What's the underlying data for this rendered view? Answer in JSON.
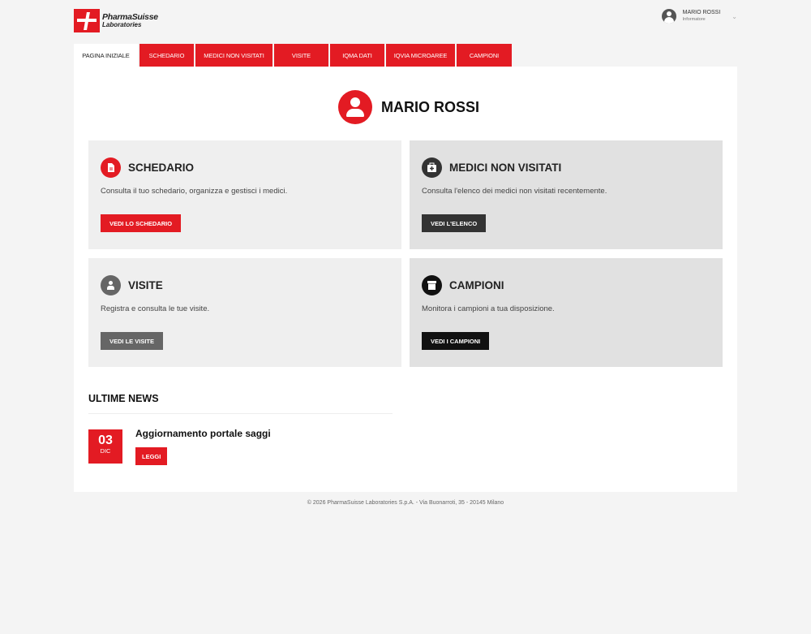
{
  "brand": {
    "name": "PharmaSuisse",
    "sub": "Laboratories",
    "color": "#e31b23"
  },
  "user": {
    "name": "MARIO ROSSI",
    "role": "Informatore",
    "icon": "user-circle-icon"
  },
  "nav": {
    "tabs": [
      {
        "label": "PAGINA INIZIALE",
        "active": true
      },
      {
        "label": "SCHEDARIO",
        "active": false
      },
      {
        "label": "MEDICI NON VISITATI",
        "active": false
      },
      {
        "label": "VISITE",
        "active": false
      },
      {
        "label": "IQMA DATI",
        "active": false
      },
      {
        "label": "IQVIA MICROAREE",
        "active": false
      },
      {
        "label": "CAMPIONI",
        "active": false
      }
    ]
  },
  "hero": {
    "name": "MARIO ROSSI"
  },
  "cards": [
    {
      "title": "SCHEDARIO",
      "description": "Consulta il tuo schedario, organizza e gestisci i medici.",
      "button": "VEDI LO SCHEDARIO",
      "icon": "document-icon",
      "icon_color": "#e31b23",
      "button_color": "#e31b23"
    },
    {
      "title": "MEDICI NON VISITATI",
      "description": "Consulta l'elenco dei medici non visitati recentemente.",
      "button": "VEDI L'ELENCO",
      "icon": "medical-bag-icon",
      "icon_color": "#333333",
      "button_color": "#333333"
    },
    {
      "title": "VISITE",
      "description": "Registra e consulta le tue visite.",
      "button": "VEDI LE VISITE",
      "icon": "person-visit-icon",
      "icon_color": "#666666",
      "button_color": "#666666"
    },
    {
      "title": "CAMPIONI",
      "description": "Monitora i campioni a tua disposizione.",
      "button": "VEDI I CAMPIONI",
      "icon": "box-icon",
      "icon_color": "#111111",
      "button_color": "#111111"
    }
  ],
  "news": {
    "title": "ULTIME NEWS",
    "items": [
      {
        "day": "03",
        "month": "DIC",
        "headline": "Aggiornamento portale saggi",
        "button": "LEGGI"
      }
    ]
  },
  "footer": {
    "text": "© 2026 PharmaSuisse Laboratories S.p.A. - Via Buonarroti, 35 - 20145 Milano"
  }
}
